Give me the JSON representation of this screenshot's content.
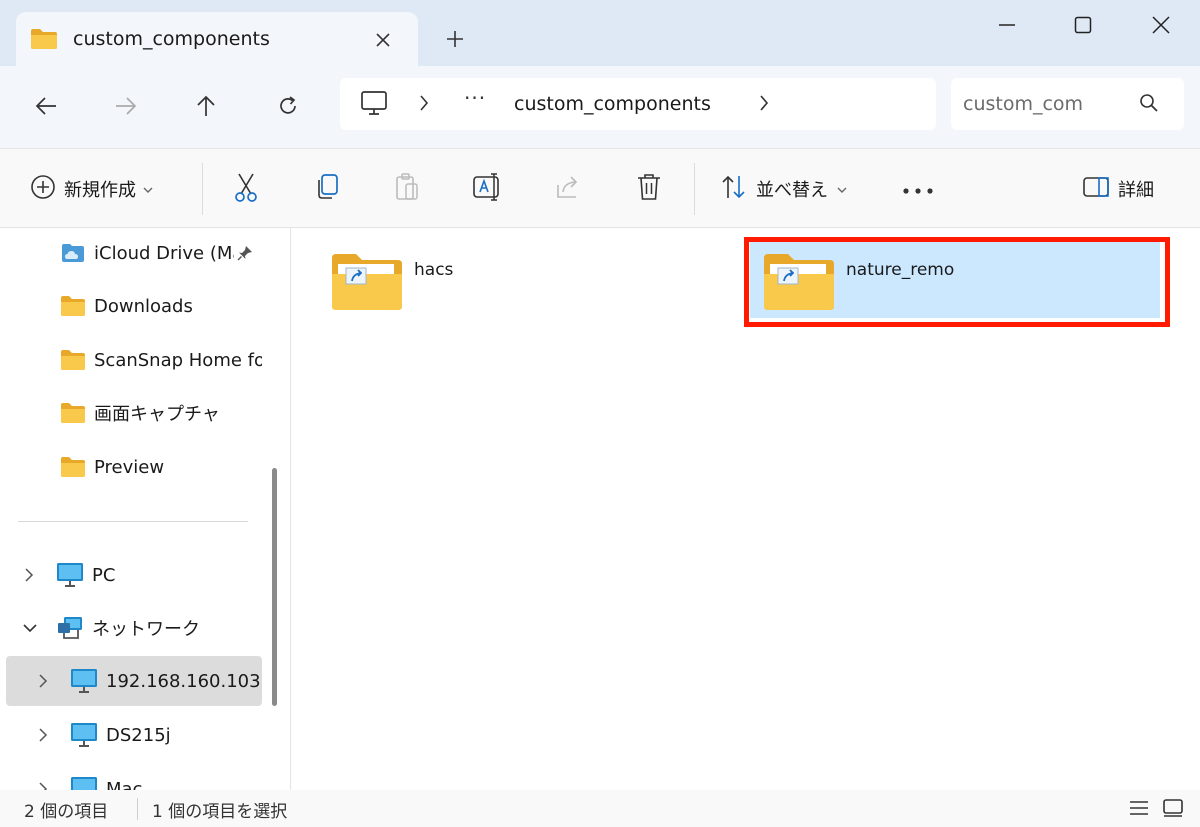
{
  "window": {
    "tab_title": "custom_components",
    "controls": {
      "minimize": "minimize",
      "maximize": "maximize",
      "close": "close"
    }
  },
  "nav": {
    "breadcrumb_more": "···",
    "breadcrumb_current": "custom_components",
    "search_placeholder": "custom_com"
  },
  "toolbar": {
    "new_label": "新規作成",
    "sort_label": "並べ替え",
    "more_label": "•••",
    "details_label": "詳細"
  },
  "sidebar": {
    "items": [
      {
        "label": "iCloud Drive (Ma",
        "icon": "icloud-icon"
      },
      {
        "label": "Downloads",
        "icon": "folder-icon"
      },
      {
        "label": "ScanSnap Home fo",
        "icon": "folder-icon"
      },
      {
        "label": "画面キャプチャ",
        "icon": "folder-icon"
      },
      {
        "label": "Preview",
        "icon": "folder-icon"
      },
      {
        "label": "PC",
        "icon": "monitor-icon"
      },
      {
        "label": "ネットワーク",
        "icon": "network-icon"
      },
      {
        "label": "192.168.160.103",
        "icon": "monitor-icon",
        "selected": true
      },
      {
        "label": "DS215j",
        "icon": "monitor-icon"
      },
      {
        "label": "Mac",
        "icon": "monitor-icon"
      }
    ]
  },
  "content": {
    "items": [
      {
        "name": "hacs",
        "icon": "shortcut-folder-icon",
        "selected": false
      },
      {
        "name": "nature_remo",
        "icon": "shortcut-folder-icon",
        "selected": true
      }
    ]
  },
  "status": {
    "item_count": "2 個の項目",
    "selected_count": "1 個の項目を選択"
  },
  "colors": {
    "accent_selected": "#cce8ff",
    "highlight_box": "#ff1a00",
    "titlebar_bg": "#dfe9f5",
    "folder_yellow": "#f8c94a"
  }
}
